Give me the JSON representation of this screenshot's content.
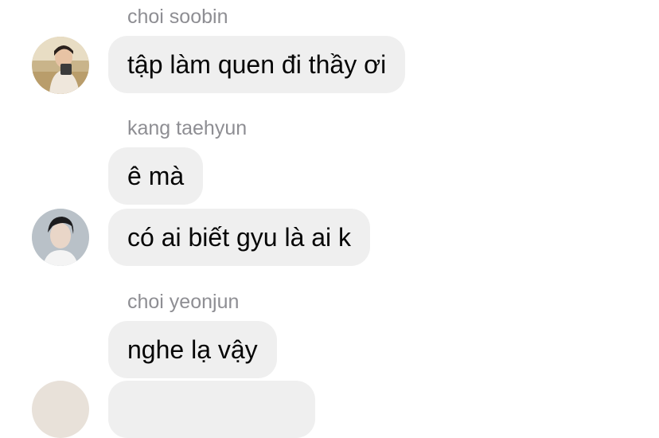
{
  "messages": [
    {
      "sender": "choi soobin",
      "bubbles": [
        "tập làm quen đi thầy ơi"
      ]
    },
    {
      "sender": "kang taehyun",
      "bubbles": [
        "ê mà",
        "có ai biết gyu là ai k"
      ]
    },
    {
      "sender": "choi yeonjun",
      "bubbles": [
        "nghe lạ vậy"
      ]
    }
  ],
  "avatars": [
    {
      "name": "choi soobin",
      "icon": "user-avatar-photo"
    },
    {
      "name": "kang taehyun",
      "icon": "user-avatar-photo"
    }
  ]
}
